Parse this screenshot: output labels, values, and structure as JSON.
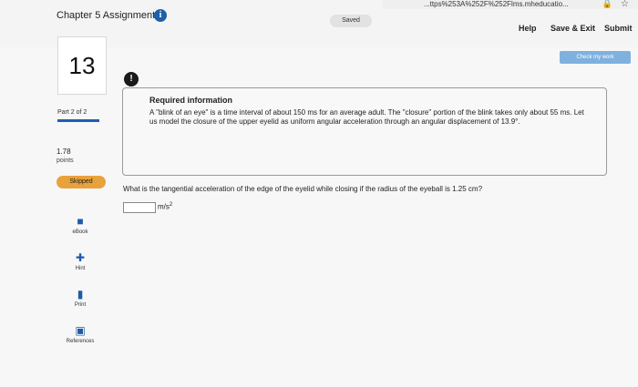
{
  "browser": {
    "url_fragment": "...ttps%253A%252F%252Flms.mheducatio...",
    "lock_icon": "lock-icon",
    "star_icon": "star-icon"
  },
  "header": {
    "title": "Chapter 5 Assignment",
    "info_icon": "info-icon",
    "saved_label": "Saved",
    "help_label": "Help",
    "save_exit_label": "Save & Exit",
    "submit_label": "Submit",
    "check_work_label": "Check my work"
  },
  "sidebar": {
    "question_number": "13",
    "part_label": "Part 2 of 2",
    "points_value": "1.78",
    "points_label": "points",
    "status_badge": "Skipped",
    "tools": [
      {
        "label": "eBook",
        "icon": "book-icon"
      },
      {
        "label": "Hint",
        "icon": "hint-icon"
      },
      {
        "label": "Print",
        "icon": "print-icon"
      },
      {
        "label": "References",
        "icon": "references-icon"
      }
    ]
  },
  "main": {
    "alert_icon": "exclamation-icon",
    "required_title": "Required information",
    "required_text": "A \"blink of an eye\" is a time interval of about 150 ms for an average adult. The \"closure\" portion of the blink takes only about 55 ms. Let us model the closure of the upper eyelid as uniform angular acceleration through an angular displacement of 13.9°.",
    "question_text": "What is the tangential acceleration of the edge of the eyelid while closing if the radius of the eyeball is 1.25 cm?",
    "answer_value": "",
    "answer_unit": "m/s",
    "answer_unit_exp": "2"
  },
  "colors": {
    "accent_blue": "#1f5db0",
    "skipped_orange": "#e9a23b",
    "check_button": "#7fb1df"
  }
}
